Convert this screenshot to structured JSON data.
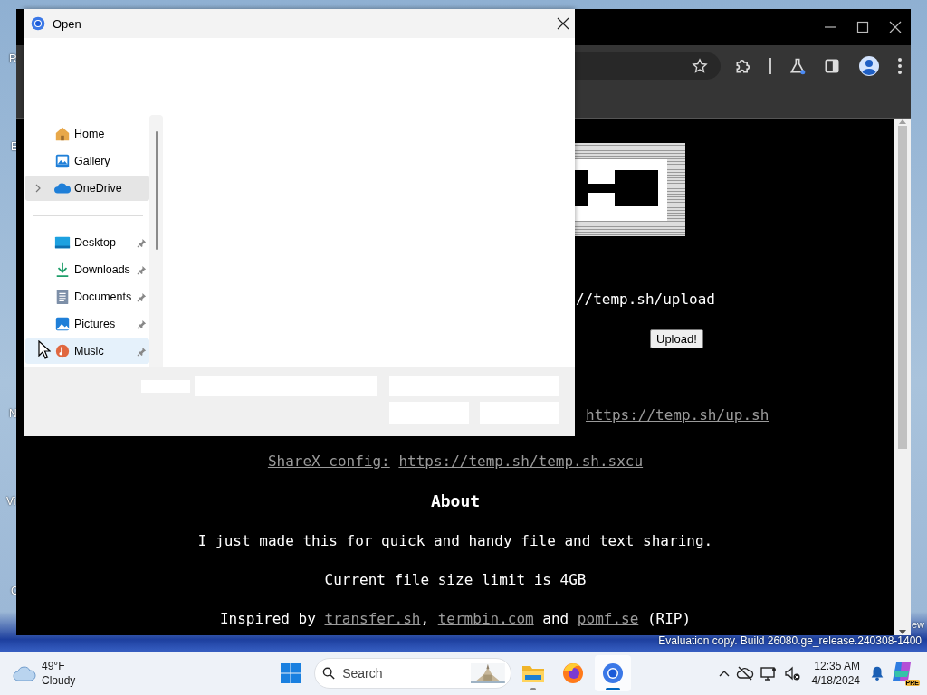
{
  "desktop": {
    "icon_labels": [
      {
        "label": "R"
      },
      {
        "label": "E"
      },
      {
        "label": "N"
      },
      {
        "label": "Vi"
      },
      {
        "label": "C"
      }
    ],
    "corner_text": "ew",
    "watermark": "Evaluation copy. Build 26080.ge_release.240308-1400"
  },
  "browser": {
    "page": {
      "upload_command": "//temp.sh/upload",
      "upload_button": "Upload!",
      "script_link": "https://temp.sh/up.sh",
      "sharex": {
        "label": "ShareX config:",
        "link": "https://temp.sh/temp.sh.sxcu"
      },
      "heading": "About",
      "paragraphs": [
        "I just made this for quick and handy file and text sharing.",
        "Current file size limit is 4GB"
      ],
      "credits": [
        {
          "kind": "text",
          "text": "Inspired by "
        },
        {
          "kind": "link",
          "text": "transfer.sh"
        },
        {
          "kind": "text",
          "text": ", "
        },
        {
          "kind": "link",
          "text": "termbin.com"
        },
        {
          "kind": "text",
          "text": " and "
        },
        {
          "kind": "link",
          "text": "pomf.se"
        },
        {
          "kind": "text",
          "text": " (RIP)"
        }
      ]
    }
  },
  "dialog": {
    "title": "Open",
    "sidebar": {
      "items": [
        {
          "kind": "home",
          "label": "Home",
          "selected": false,
          "hovered": false,
          "pinned": false,
          "expandable": false
        },
        {
          "kind": "gallery",
          "label": "Gallery",
          "selected": false,
          "hovered": false,
          "pinned": false,
          "expandable": false
        },
        {
          "kind": "cloud",
          "label": "OneDrive",
          "selected": true,
          "hovered": false,
          "pinned": false,
          "expandable": true
        },
        {
          "kind": "divider"
        },
        {
          "kind": "desktop",
          "label": "Desktop",
          "selected": false,
          "hovered": false,
          "pinned": true,
          "expandable": false
        },
        {
          "kind": "downloads",
          "label": "Downloads",
          "selected": false,
          "hovered": false,
          "pinned": true,
          "expandable": false
        },
        {
          "kind": "documents",
          "label": "Documents",
          "selected": false,
          "hovered": false,
          "pinned": true,
          "expandable": false
        },
        {
          "kind": "pictures",
          "label": "Pictures",
          "selected": false,
          "hovered": false,
          "pinned": true,
          "expandable": false
        },
        {
          "kind": "music",
          "label": "Music",
          "selected": false,
          "hovered": true,
          "pinned": true,
          "expandable": false
        }
      ]
    }
  },
  "taskbar": {
    "weather": {
      "temperature": "49°F",
      "condition": "Cloudy"
    },
    "search": {
      "placeholder": "Search"
    },
    "apps": [
      {
        "kind": "files",
        "running": true,
        "active": false
      },
      {
        "kind": "firefox",
        "running": false,
        "active": false
      },
      {
        "kind": "chrome",
        "running": true,
        "active": true
      }
    ],
    "clock": {
      "time": "12:35 AM",
      "date": "4/18/2024"
    },
    "copilot_badge": "PRE"
  }
}
